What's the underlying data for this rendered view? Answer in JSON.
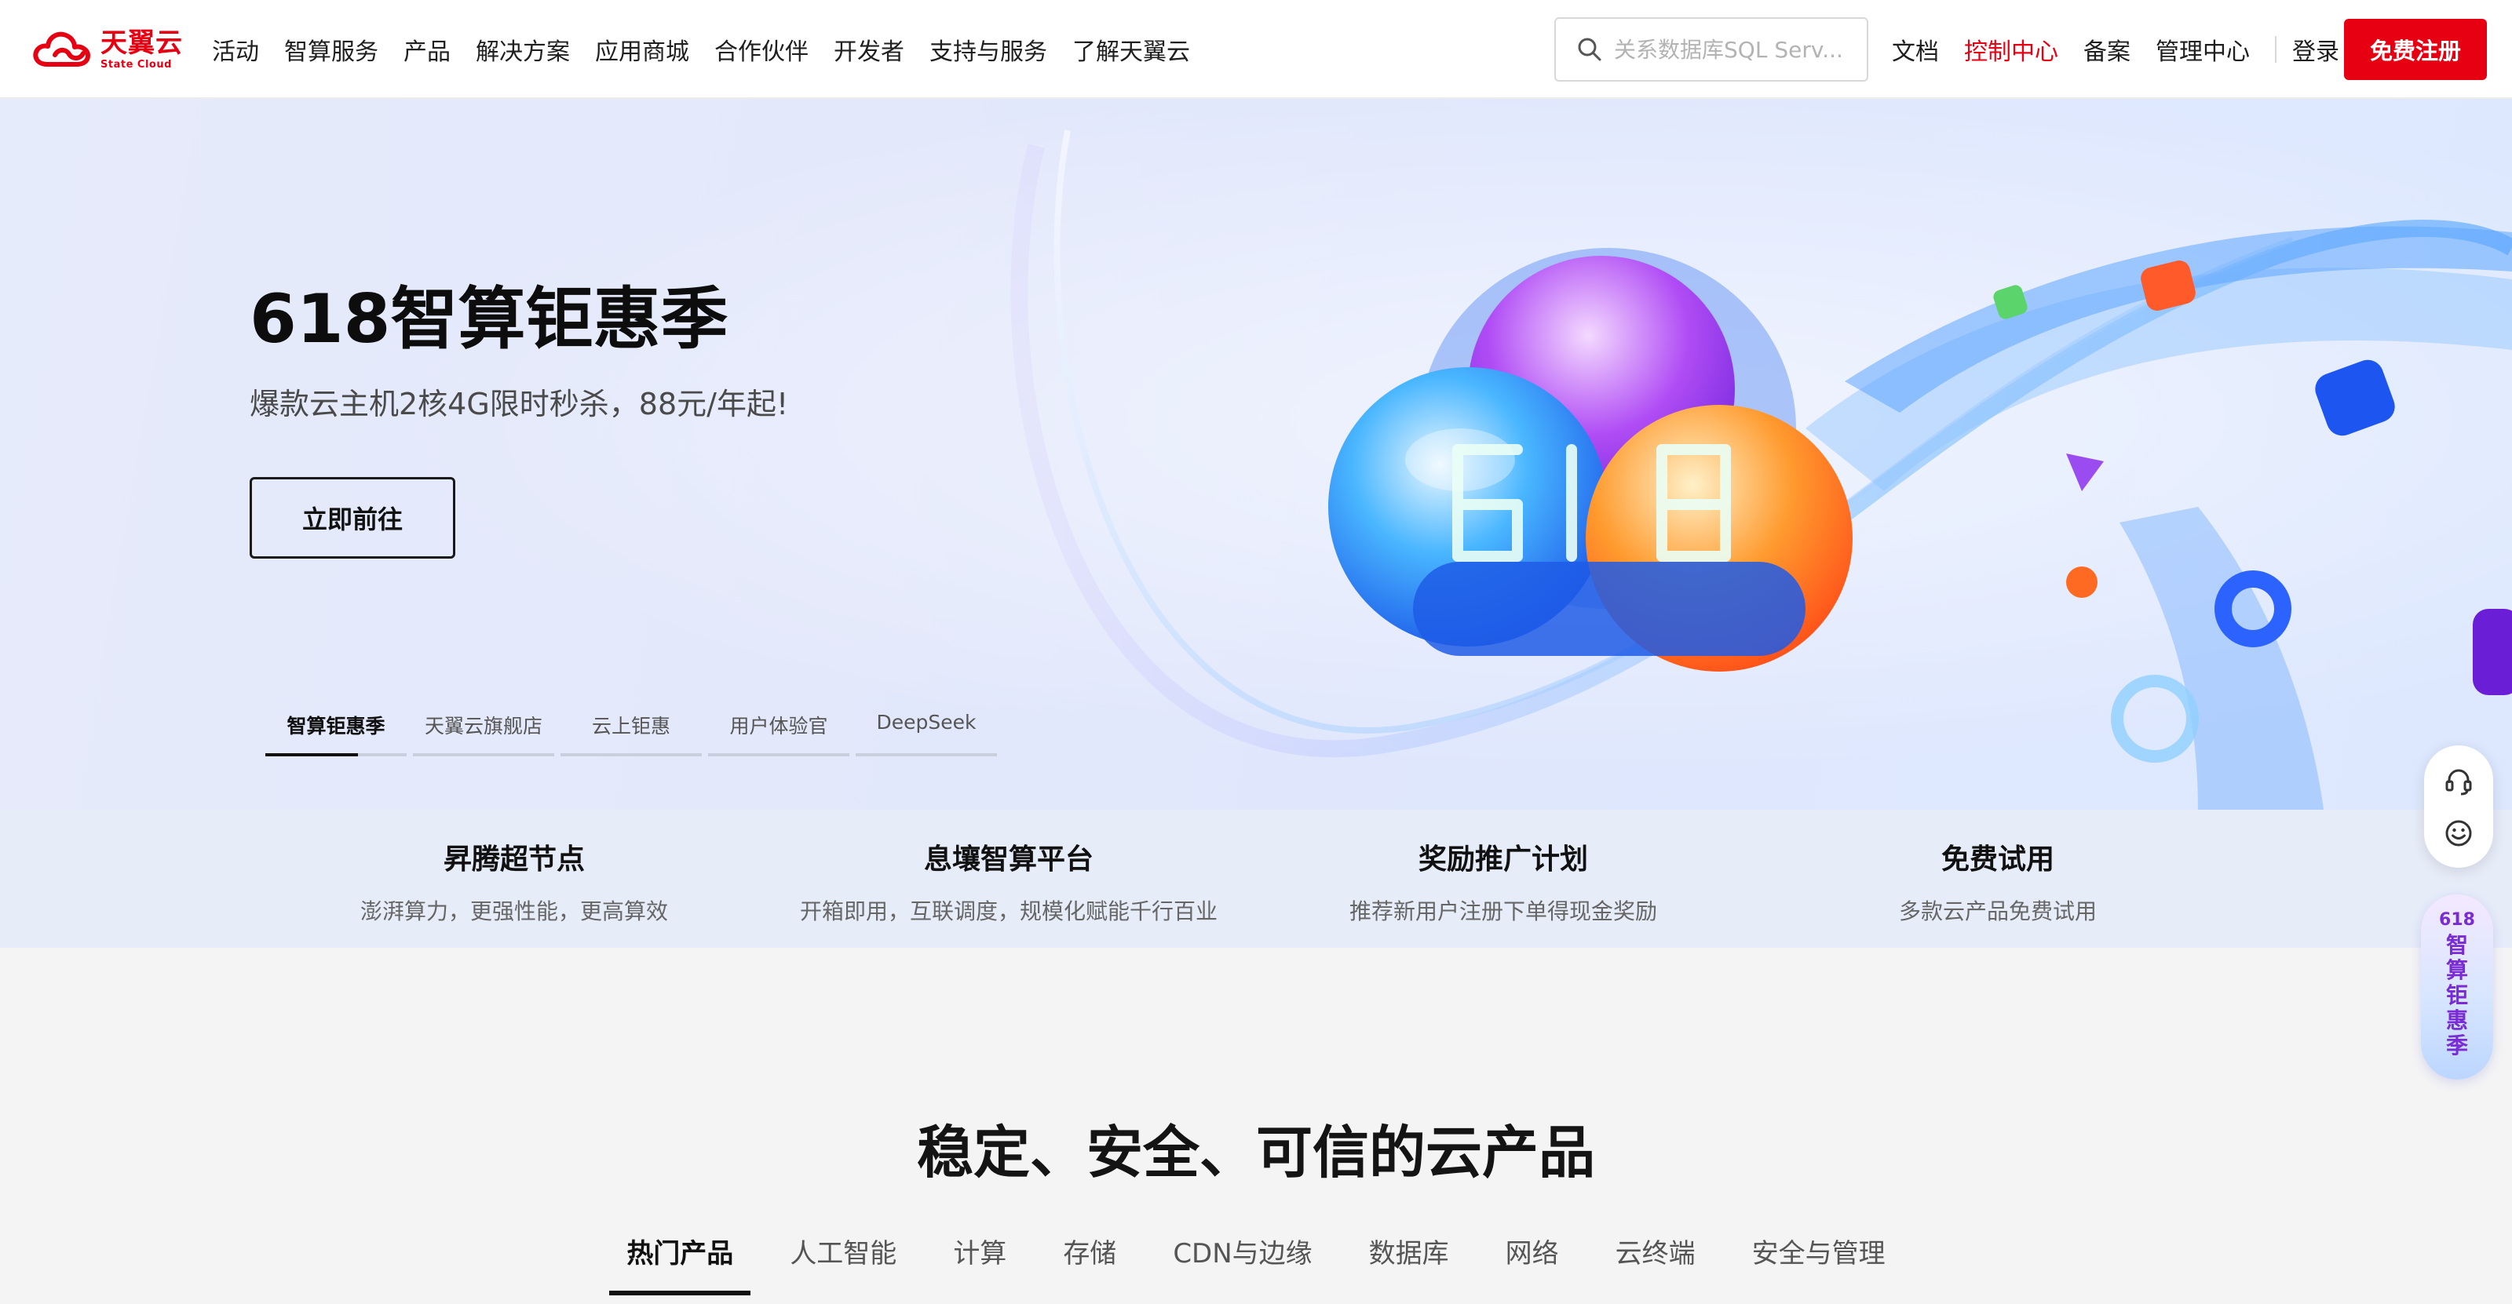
{
  "header": {
    "logo_cn": "天翼云",
    "logo_en": "State Cloud",
    "nav": [
      "活动",
      "智算服务",
      "产品",
      "解决方案",
      "应用商城",
      "合作伙伴",
      "开发者",
      "支持与服务",
      "了解天翼云"
    ],
    "search_placeholder": "关系数据库SQL Serv...",
    "links": [
      "文档",
      "控制中心",
      "备案",
      "管理中心"
    ],
    "login": "登录",
    "register": "免费注册"
  },
  "hero": {
    "title": "618智算钜惠季",
    "subtitle": "爆款云主机2核4G限时秒杀，88元/年起!",
    "button": "立即前往",
    "tabs": [
      "智算钜惠季",
      "天翼云旗舰店",
      "云上钜惠",
      "用户体验官",
      "DeepSeek"
    ],
    "active_tab": 0
  },
  "features": [
    {
      "title": "昇腾超节点",
      "desc": "澎湃算力，更强性能，更高算效"
    },
    {
      "title": "息壤智算平台",
      "desc": "开箱即用，互联调度，规模化赋能千行百业"
    },
    {
      "title": "奖励推广计划",
      "desc": "推荐新用户注册下单得现金奖励"
    },
    {
      "title": "免费试用",
      "desc": "多款云产品免费试用"
    }
  ],
  "products": {
    "title": "稳定、安全、可信的云产品",
    "tabs": [
      "热门产品",
      "人工智能",
      "计算",
      "存储",
      "CDN与边缘",
      "数据库",
      "网络",
      "云终端",
      "安全与管理"
    ],
    "active_tab": 0
  },
  "side": {
    "promo_num": "618",
    "promo_text": "智算钜惠季"
  },
  "colors": {
    "brand_red": "#e60012",
    "promo_purple": "#7a2bd4"
  }
}
